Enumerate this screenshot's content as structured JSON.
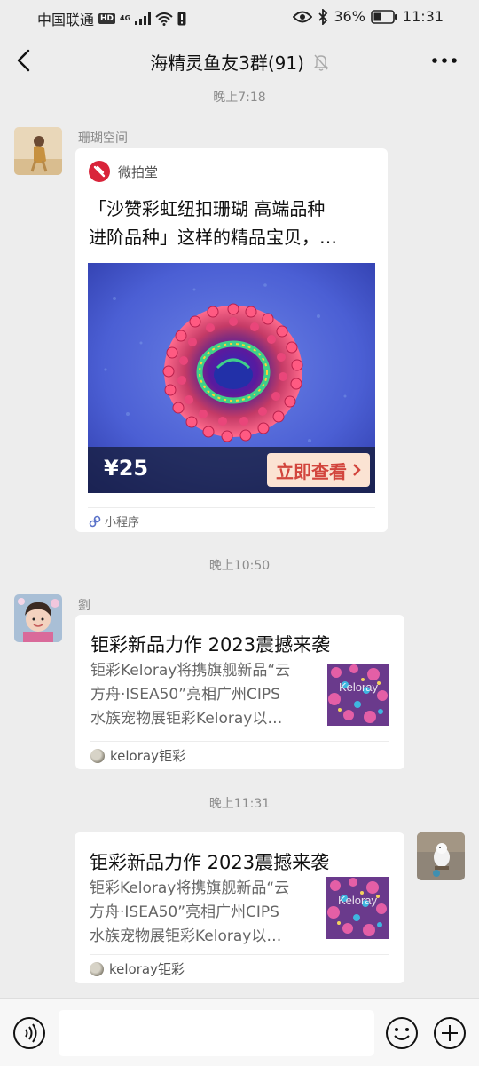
{
  "status_bar": {
    "carrier": "中国联通",
    "hd_badge": "HD",
    "network": "4G",
    "battery": "36%",
    "time": "11:31"
  },
  "nav": {
    "title": "海精灵鱼友3群(91)",
    "back_icon": "chevron-left-icon",
    "more_icon": "more-dots-icon",
    "mute_icon": "bell-off-icon"
  },
  "chat": {
    "messages": [
      {
        "time": "晚上7:18",
        "sender": "珊瑚空间",
        "type": "mini-program",
        "app_name": "微拍堂",
        "title_lines": [
          "「沙赞彩虹纽扣珊瑚  高端品种",
          "进阶品种」这样的精品宝贝，…"
        ],
        "price": "¥25",
        "cta": "立即查看",
        "footer": "小程序"
      },
      {
        "time": "晚上10:50",
        "sender": "劉",
        "type": "article",
        "title": "钜彩新品力作 2023震撼来袭",
        "desc_lines": [
          "钜彩Keloray将携旗舰新品“云",
          "方舟·ISEA50”亮相广州CIPS",
          "水族宠物展钜彩Keloray以…"
        ],
        "thumb_text": "Keloray",
        "source": "keloray钜彩"
      },
      {
        "time": "晚上11:31",
        "sender": "",
        "type": "article",
        "outgoing": true,
        "title": "钜彩新品力作 2023震撼来袭",
        "desc_lines": [
          "钜彩Keloray将携旗舰新品“云",
          "方舟·ISEA50”亮相广州CIPS",
          "水族宠物展钜彩Keloray以…"
        ],
        "thumb_text": "Keloray",
        "source": "keloray钜彩"
      }
    ]
  },
  "input_bar": {
    "voice_icon": "voice-icon",
    "emoji_icon": "emoji-icon",
    "plus_icon": "plus-icon",
    "text": ""
  },
  "colors": {
    "background": "#ededed",
    "bubble": "#ffffff",
    "cta_text": "#d2453d",
    "cta_bg": "#fbe3d3",
    "brand_logo": "#d9243a"
  }
}
